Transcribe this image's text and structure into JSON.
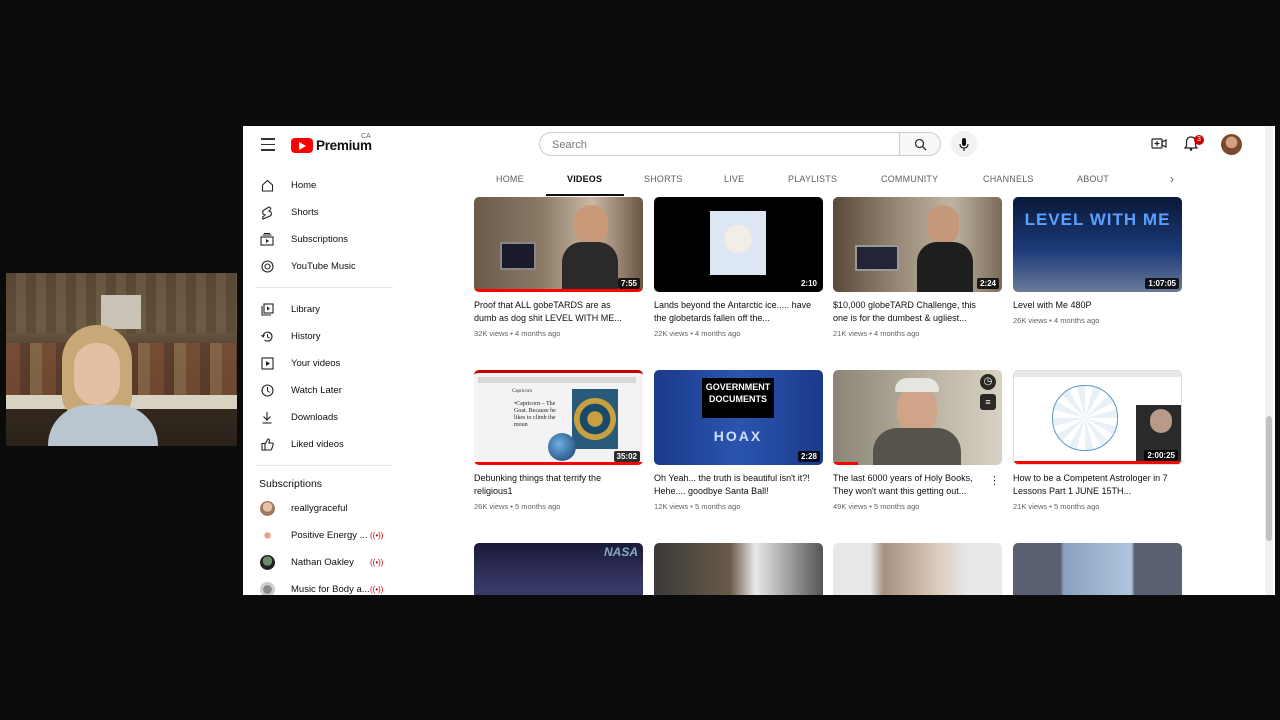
{
  "app": {
    "logo_text": "Premium",
    "country_code": "CA"
  },
  "search": {
    "placeholder": "Search"
  },
  "header": {
    "notification_count": "3"
  },
  "sidebar": {
    "items": [
      {
        "label": "Home",
        "icon": "home-icon"
      },
      {
        "label": "Shorts",
        "icon": "shorts-icon"
      },
      {
        "label": "Subscriptions",
        "icon": "subscriptions-icon"
      },
      {
        "label": "YouTube Music",
        "icon": "music-icon"
      },
      {
        "label": "Library",
        "icon": "library-icon"
      },
      {
        "label": "History",
        "icon": "history-icon"
      },
      {
        "label": "Your videos",
        "icon": "your-videos-icon"
      },
      {
        "label": "Watch Later",
        "icon": "clock-icon"
      },
      {
        "label": "Downloads",
        "icon": "download-icon"
      },
      {
        "label": "Liked videos",
        "icon": "thumbs-up-icon"
      }
    ],
    "subscriptions_heading": "Subscriptions",
    "subscriptions": [
      {
        "name": "reallygraceful",
        "live": false
      },
      {
        "name": "Positive Energy ...",
        "live": true
      },
      {
        "name": "Nathan Oakley",
        "live": true
      },
      {
        "name": "Music for Body a...",
        "live": true
      }
    ]
  },
  "tabs": [
    "HOME",
    "VIDEOS",
    "SHORTS",
    "LIVE",
    "PLAYLISTS",
    "COMMUNITY",
    "CHANNELS",
    "ABOUT"
  ],
  "active_tab": "VIDEOS",
  "videos": [
    {
      "title": "Proof that ALL gobeTARDS are as dumb as dog shit LEVEL WITH ME...",
      "views": "32K views",
      "age": "4 months ago",
      "duration": "7:55",
      "progress": 1.0
    },
    {
      "title": "Lands beyond the Antarctic ice..... have the globetards fallen off the...",
      "views": "22K views",
      "age": "4 months ago",
      "duration": "2:10",
      "progress": 0
    },
    {
      "title": "$10,000 globeTARD Challenge, this one is for the dumbest & ugliest...",
      "views": "21K views",
      "age": "4 months ago",
      "duration": "2:24",
      "progress": 0
    },
    {
      "title": "Level with Me 480P",
      "views": "26K views",
      "age": "4 months ago",
      "duration": "1:07:05",
      "progress": 0
    },
    {
      "title": "Debunking things that terrify the religious1",
      "views": "26K views",
      "age": "5 months ago",
      "duration": "35:02",
      "progress": 1.0
    },
    {
      "title": "Oh Yeah... the truth is beautiful isn't it?! Hehe.... goodbye Santa Ball!",
      "views": "12K views",
      "age": "5 months ago",
      "duration": "2:28",
      "progress": 0
    },
    {
      "title": "The last 6000 years of Holy Books, They won't want this getting out...",
      "views": "49K views",
      "age": "5 months ago",
      "duration": "",
      "progress": 0.15
    },
    {
      "title": "How to be a Competent Astrologer in 7 Lessons Part 1 JUNE 15TH...",
      "views": "21K views",
      "age": "5 months ago",
      "duration": "2:00:25",
      "progress": 1.0
    }
  ],
  "thumb_texts": {
    "level_with_me": "LEVEL WITH ME",
    "government": "GOVERNMENT",
    "documents": "DOCUMENTS",
    "hoax": "HOAX",
    "nasa": "NASA",
    "capricorn": "Capricorn",
    "capricorn_body": "•Capricorn – The Goat. Because he likes to climb the moun"
  },
  "colors": {
    "brand_red": "#ff0000",
    "progress_red": "#ff0000",
    "live_red": "#cc0000"
  }
}
